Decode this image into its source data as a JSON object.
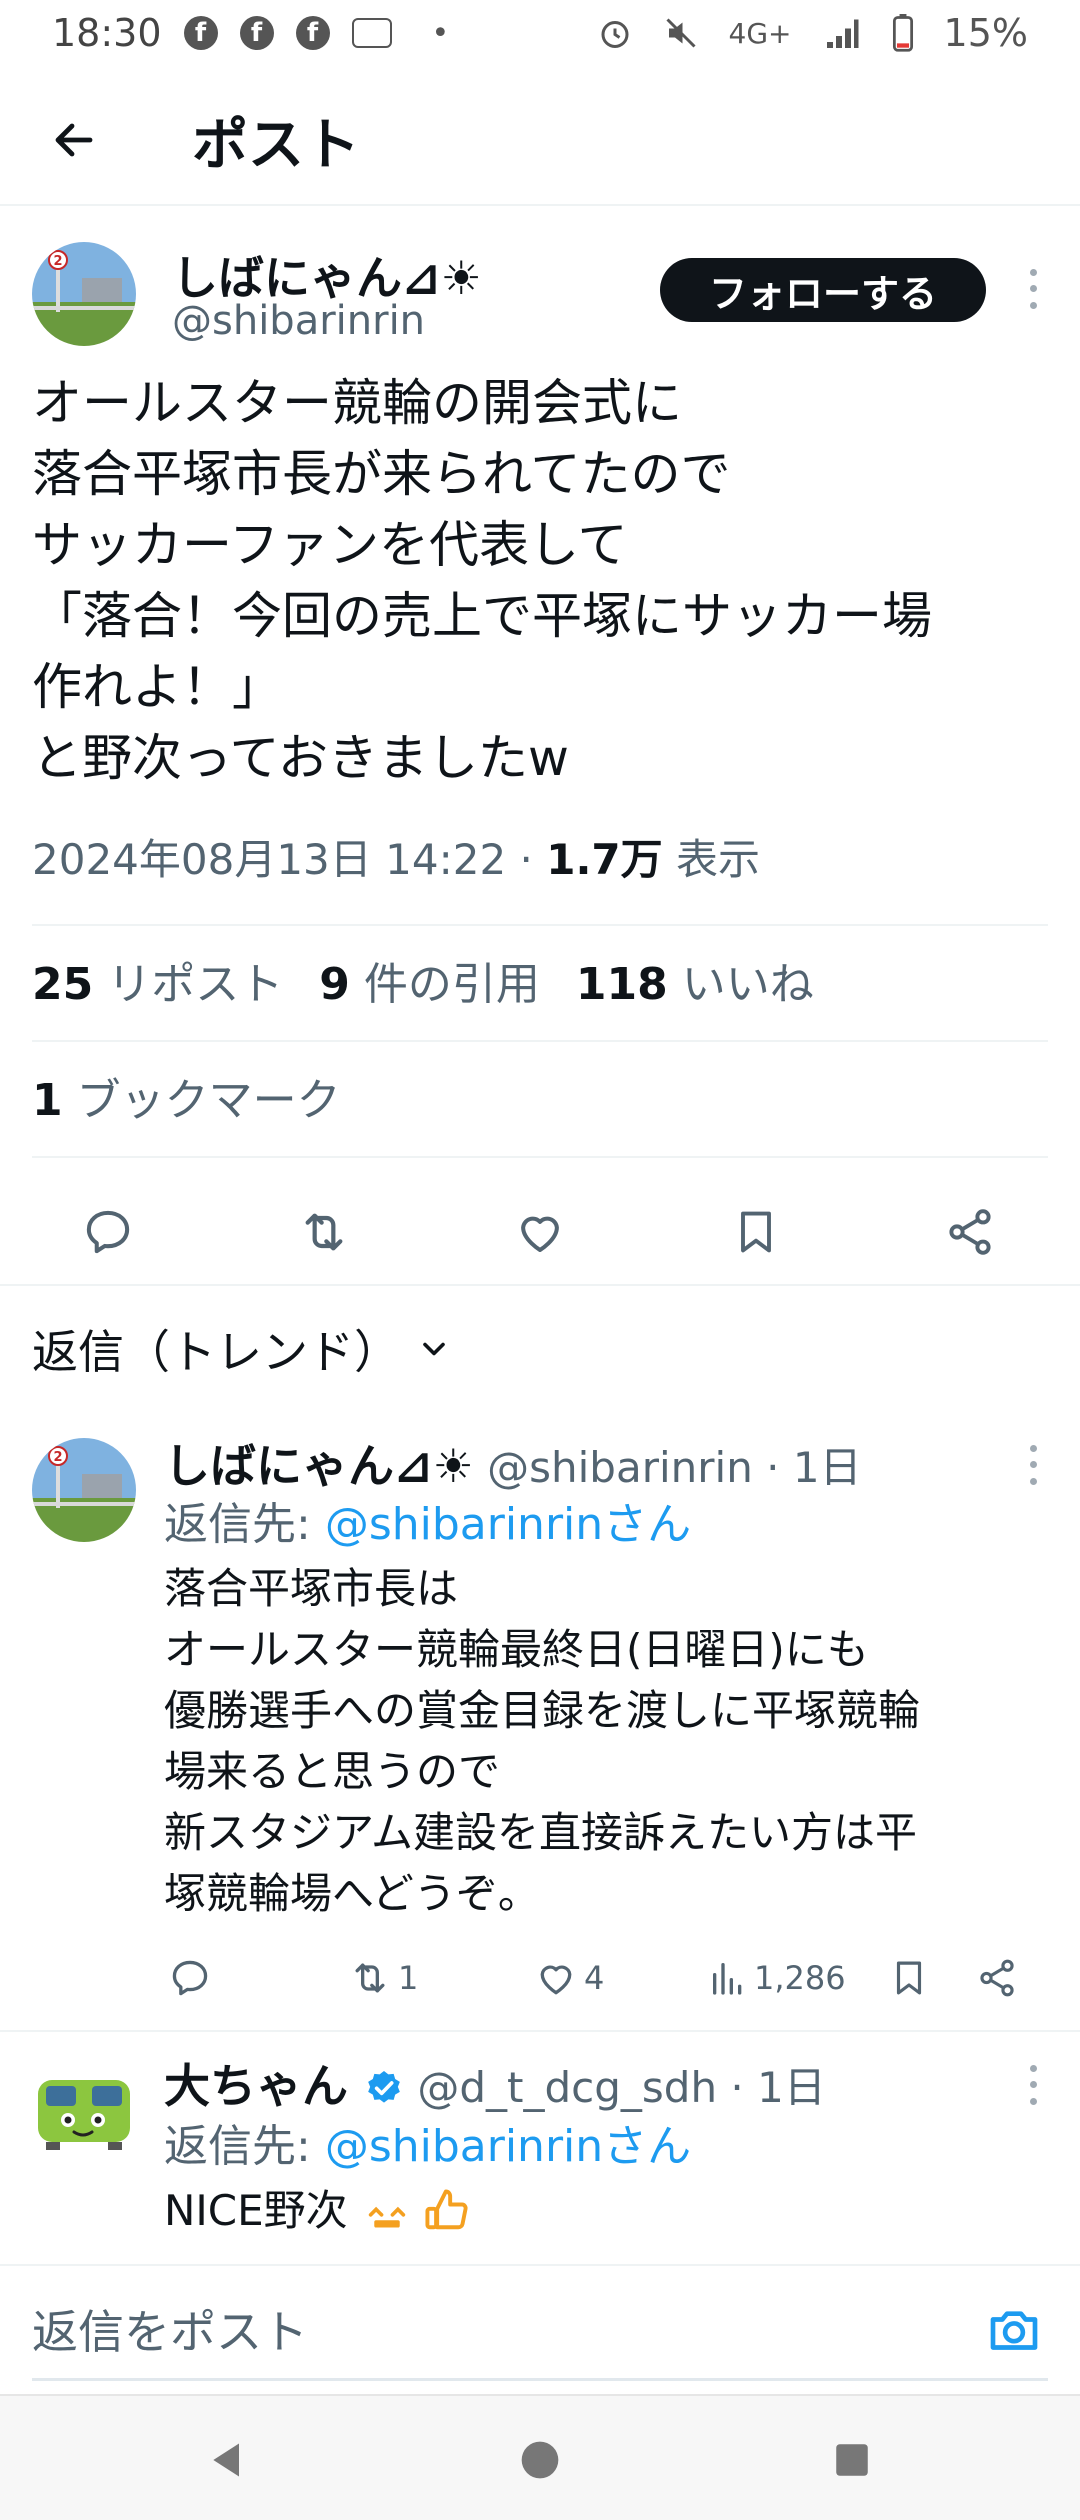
{
  "status_bar": {
    "time": "18:30",
    "notif_fb": "f",
    "network": "4G+",
    "battery": "15%"
  },
  "header": {
    "title": "ポスト"
  },
  "post": {
    "author_name": "しばにゃん⊿☀",
    "author_handle": "@shibarinrin",
    "follow_label": "フォローする",
    "text_lines": [
      "オールスター競輪の開会式に",
      "落合平塚市長が来られてたので",
      "サッカーファンを代表して",
      "「落合！今回の売上で平塚にサッカー場",
      "作れよ！」",
      "と野次っておきましたw"
    ],
    "datetime": "2024年08月13日 14:22 · ",
    "views_count": "1.7万",
    "views_label": " 表示",
    "reposts_count": "25",
    "reposts_label": " リポスト",
    "quotes_count": "9",
    "quotes_label": " 件の引用",
    "likes_count": "118",
    "likes_label": " いいね",
    "bookmarks_count": "1",
    "bookmarks_label": " ブックマーク"
  },
  "replies_sort": {
    "label": "返信（トレンド）"
  },
  "replies": [
    {
      "name": "しばにゃん⊿☀",
      "handle_time": " @shibarinrin · 1日",
      "reply_to_prefix": "返信先: ",
      "reply_to_link": "@shibarinrinさん",
      "text_lines": [
        "落合平塚市長は",
        "オールスター競輪最終日(日曜日)にも",
        "優勝選手への賞金目録を渡しに平塚競輪",
        "場来ると思うので",
        "新スタジアム建設を直接訴えたい方は平",
        "塚競輪場へどうぞ。"
      ],
      "reposts": "1",
      "likes": "4",
      "views": "1,286"
    },
    {
      "name": "大ちゃん",
      "handle_time": " @d_t_dcg_sdh · 1日",
      "reply_to_prefix": "返信先: ",
      "reply_to_link": "@shibarinrinさん",
      "text": "NICE野次"
    }
  ],
  "compose": {
    "placeholder": "返信をポスト"
  },
  "colors": {
    "accent": "#1d9bf0",
    "text": "#0f1419",
    "secondary": "#536471",
    "follow_bg": "#0f1419",
    "verified": "#1d9bf0"
  },
  "icons": [
    "back-arrow-icon",
    "more-icon",
    "reply-icon",
    "repost-icon",
    "like-icon",
    "bookmark-icon",
    "share-icon",
    "chevron-down-icon",
    "views-icon",
    "verified-icon",
    "camera-icon"
  ]
}
